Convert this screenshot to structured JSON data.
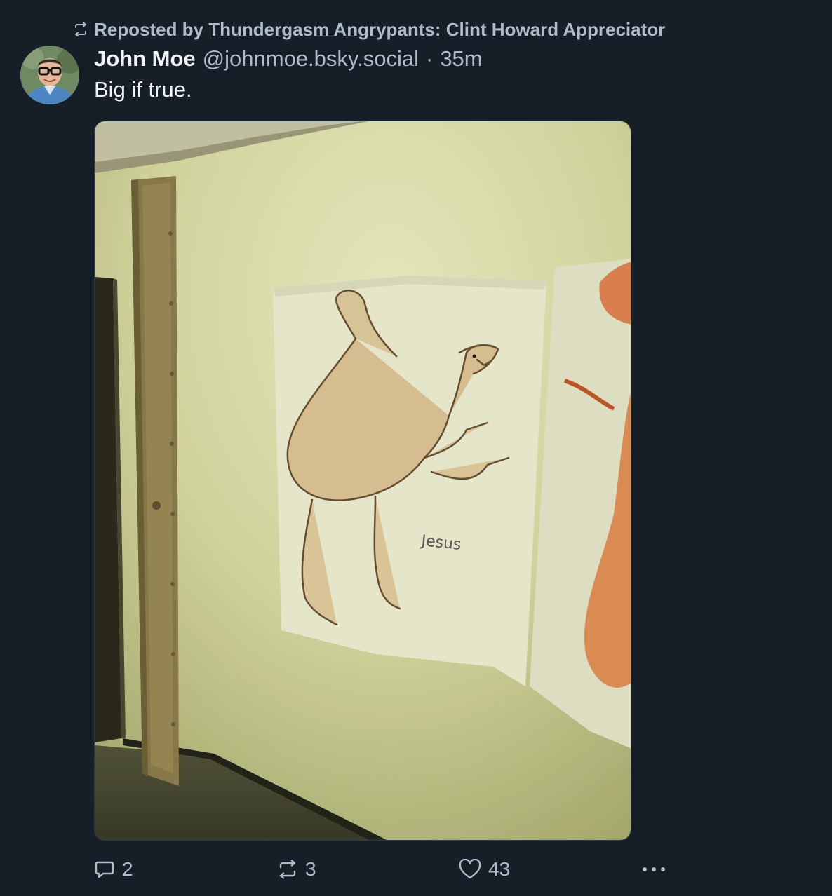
{
  "repost": {
    "label": "Reposted by Thundergasm Angrypants: Clint Howard Appreciator",
    "icon": "repost-icon"
  },
  "author": {
    "display_name": "John Moe",
    "handle": "@johnmoe.bsky.social",
    "separator": "·",
    "time": "35m"
  },
  "post": {
    "text": "Big if true.",
    "image_caption_handwriting": "Jesus"
  },
  "actions": {
    "reply_count": "2",
    "repost_count": "3",
    "like_count": "43"
  },
  "colors": {
    "background": "#161e27",
    "text_primary": "#f1f3f5",
    "text_secondary": "#aebbc9"
  }
}
